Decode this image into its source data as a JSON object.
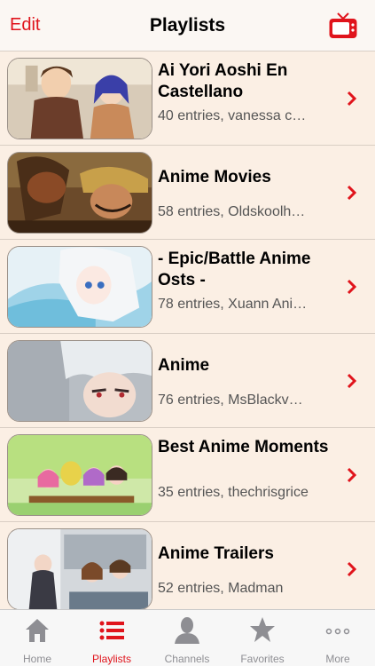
{
  "navbar": {
    "edit_label": "Edit",
    "title": "Playlists",
    "tv_icon": "tv-icon"
  },
  "playlists": [
    {
      "title": "Ai Yori Aoshi En Castellano",
      "subtitle": "40 entries, vanessa c…"
    },
    {
      "title": "Anime Movies",
      "subtitle": "58 entries, Oldskoolh…"
    },
    {
      "title": "- Epic/Battle Anime Osts -",
      "subtitle": "78 entries, Xuann Ani…"
    },
    {
      "title": "Anime",
      "subtitle": "76 entries, MsBlackv…"
    },
    {
      "title": "Best Anime Moments",
      "subtitle": "35 entries, thechrisgrice"
    },
    {
      "title": "Anime Trailers",
      "subtitle": "52 entries, Madman"
    }
  ],
  "tabbar": {
    "items": [
      {
        "label": "Home",
        "icon": "home-icon"
      },
      {
        "label": "Playlists",
        "icon": "list-icon",
        "active": true
      },
      {
        "label": "Channels",
        "icon": "person-icon"
      },
      {
        "label": "Favorites",
        "icon": "star-icon"
      },
      {
        "label": "More",
        "icon": "more-icon"
      }
    ]
  },
  "colors": {
    "accent": "#e0141c",
    "row_background": "#fbefe4",
    "inactive_tab": "#8e8e93"
  }
}
